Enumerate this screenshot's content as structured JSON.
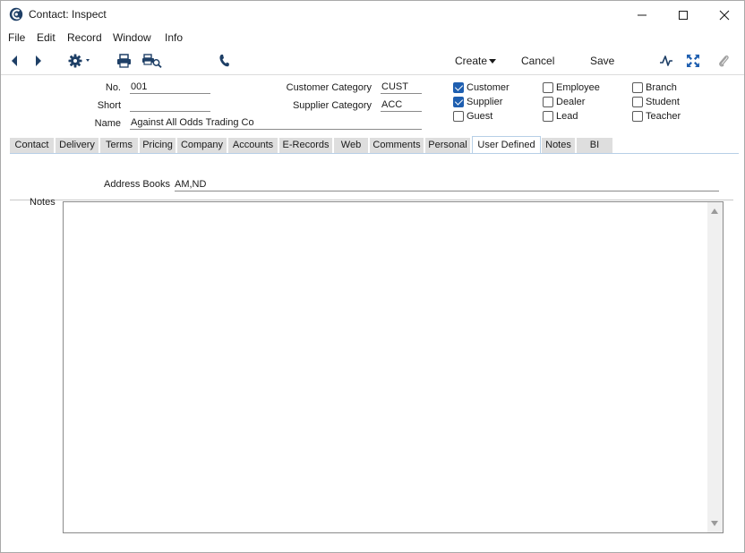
{
  "window": {
    "title": "Contact: Inspect"
  },
  "menu": [
    "File",
    "Edit",
    "Record",
    "Window",
    "Info"
  ],
  "toolbar": {
    "create_label": "Create",
    "cancel_label": "Cancel",
    "save_label": "Save"
  },
  "header": {
    "no_label": "No.",
    "no_value": "001",
    "short_label": "Short",
    "short_value": "",
    "name_label": "Name",
    "name_value": "Against All Odds Trading Co",
    "customer_category_label": "Customer Category",
    "customer_category_value": "CUST",
    "supplier_category_label": "Supplier Category",
    "supplier_category_value": "ACC"
  },
  "checkboxes": [
    {
      "label": "Customer",
      "checked": true
    },
    {
      "label": "Supplier",
      "checked": true
    },
    {
      "label": "Guest",
      "checked": false
    },
    {
      "label": "Employee",
      "checked": false
    },
    {
      "label": "Dealer",
      "checked": false
    },
    {
      "label": "Lead",
      "checked": false
    },
    {
      "label": "Branch",
      "checked": false
    },
    {
      "label": "Student",
      "checked": false
    },
    {
      "label": "Teacher",
      "checked": false
    }
  ],
  "tabs": [
    "Contact",
    "Delivery",
    "Terms",
    "Pricing",
    "Company",
    "Accounts",
    "E-Records",
    "Web",
    "Comments",
    "Personal",
    "User Defined",
    "Notes",
    "BI"
  ],
  "active_tab": "User Defined",
  "user_defined": {
    "address_books_label": "Address Books",
    "address_books_value": "AM,ND",
    "notes_label": "Notes",
    "notes_value": ""
  },
  "colors": {
    "accent": "#1f5fb0",
    "tab_inactive": "#dedede",
    "tab_border": "#b7cfe6"
  }
}
